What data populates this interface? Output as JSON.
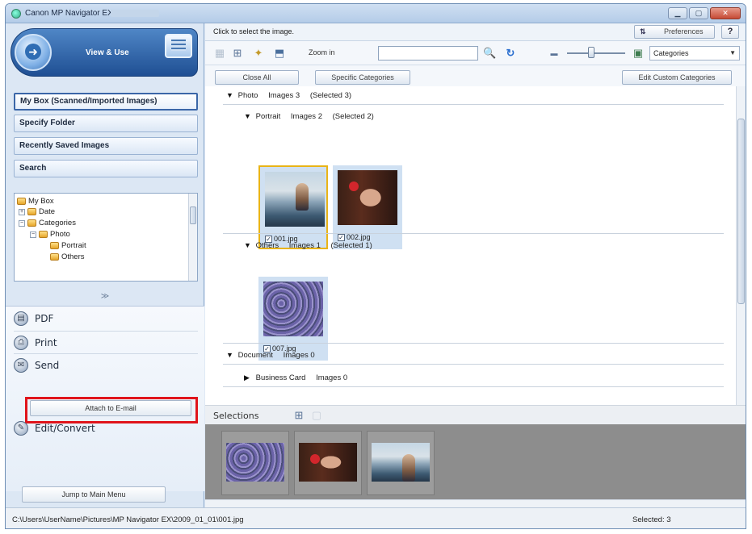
{
  "window": {
    "title": "Canon MP Navigator EX"
  },
  "left_panel": {
    "header_label": "View & Use",
    "nav_buttons": [
      "My Box (Scanned/Imported Images)",
      "Specify Folder",
      "Recently Saved Images",
      "Search"
    ],
    "tree": [
      "My Box",
      "Date",
      "Categories",
      "Photo",
      "Portrait",
      "Others"
    ],
    "collapse_glyph": "≫",
    "tasks": [
      "PDF",
      "Print",
      "Send",
      "Edit/Convert"
    ],
    "attach_label": "Attach to E-mail",
    "jump_label": "Jump to Main Menu"
  },
  "right_panel": {
    "instruction": "Click to select the image.",
    "preferences_label": "Preferences",
    "help_label": "?",
    "zoom_label": "Zoom in",
    "category_select": "Categories",
    "close_all_label": "Close All",
    "specific_categories_label": "Specific Categories",
    "edit_custom_label": "Edit Custom Categories",
    "groups": {
      "photo": {
        "name": "Photo",
        "count": "Images 3",
        "selected": "(Selected 3)"
      },
      "portrait": {
        "name": "Portrait",
        "count": "Images 2",
        "selected": "(Selected 2)"
      },
      "others": {
        "name": "Others",
        "count": "Images 1",
        "selected": "(Selected 1)"
      },
      "document": {
        "name": "Document",
        "count": "Images 0"
      },
      "business_card": {
        "name": "Business Card",
        "count": "Images 0"
      }
    },
    "thumbs": [
      "001.jpg",
      "002.jpg",
      "007.jpg"
    ],
    "selections_title": "Selections"
  },
  "status": {
    "path": "C:\\Users\\UserName\\Pictures\\MP Navigator EX\\2009_01_01\\001.jpg",
    "selected": "Selected: 3"
  },
  "colors": {
    "accent": "#1f4f93",
    "highlight": "#e0141b",
    "selected_border": "#e9b417"
  }
}
